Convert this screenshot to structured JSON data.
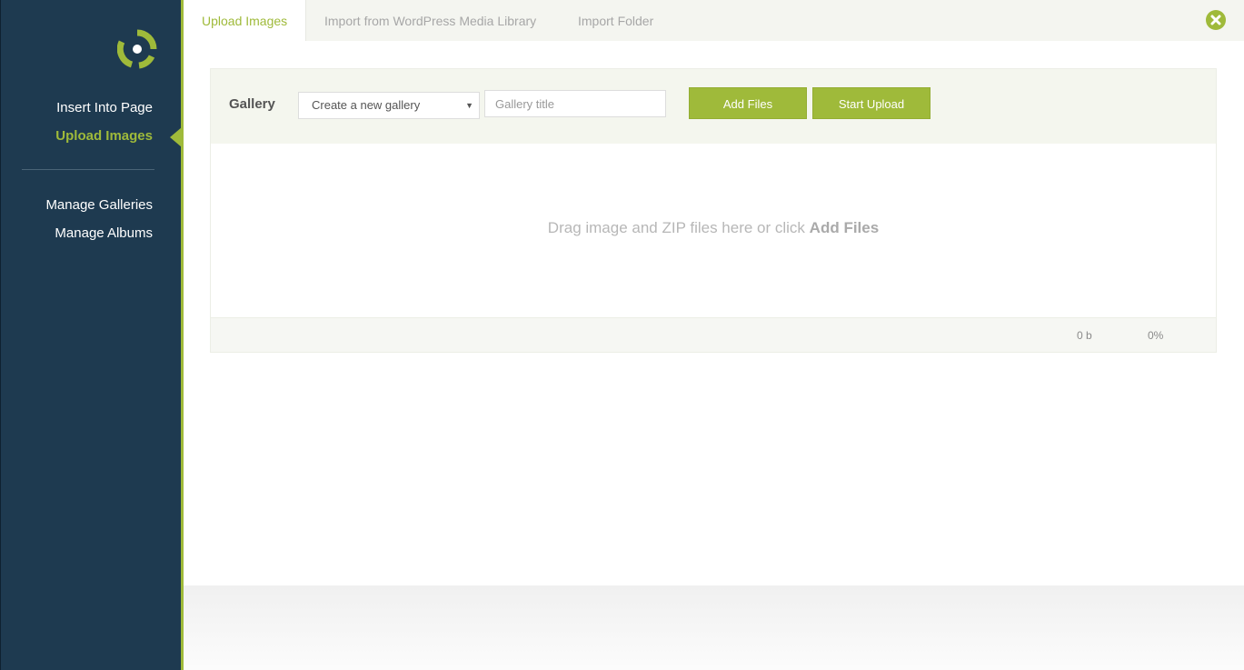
{
  "sidebar": {
    "items_top": [
      {
        "label": "Insert Into Page",
        "active": false
      },
      {
        "label": "Upload Images",
        "active": true
      }
    ],
    "items_bottom": [
      {
        "label": "Manage Galleries"
      },
      {
        "label": "Manage Albums"
      }
    ]
  },
  "tabs": [
    {
      "label": "Upload Images",
      "active": true
    },
    {
      "label": "Import from WordPress Media Library",
      "active": false
    },
    {
      "label": "Import Folder",
      "active": false
    }
  ],
  "form": {
    "gallery_label": "Gallery",
    "select_value": "Create a new gallery",
    "title_placeholder": "Gallery title",
    "add_files_label": "Add Files",
    "start_upload_label": "Start Upload"
  },
  "dropzone": {
    "text": "Drag image and ZIP files here or click",
    "emphasis": "Add Files"
  },
  "footer": {
    "size": "0 b",
    "percent": "0%"
  },
  "icons": {
    "logo": "nextgen-gallery-logo-icon",
    "close": "close-icon",
    "caret": "caret-down-icon"
  },
  "colors": {
    "accent": "#9fba3a",
    "sidebar_bg": "#1e3a50"
  }
}
